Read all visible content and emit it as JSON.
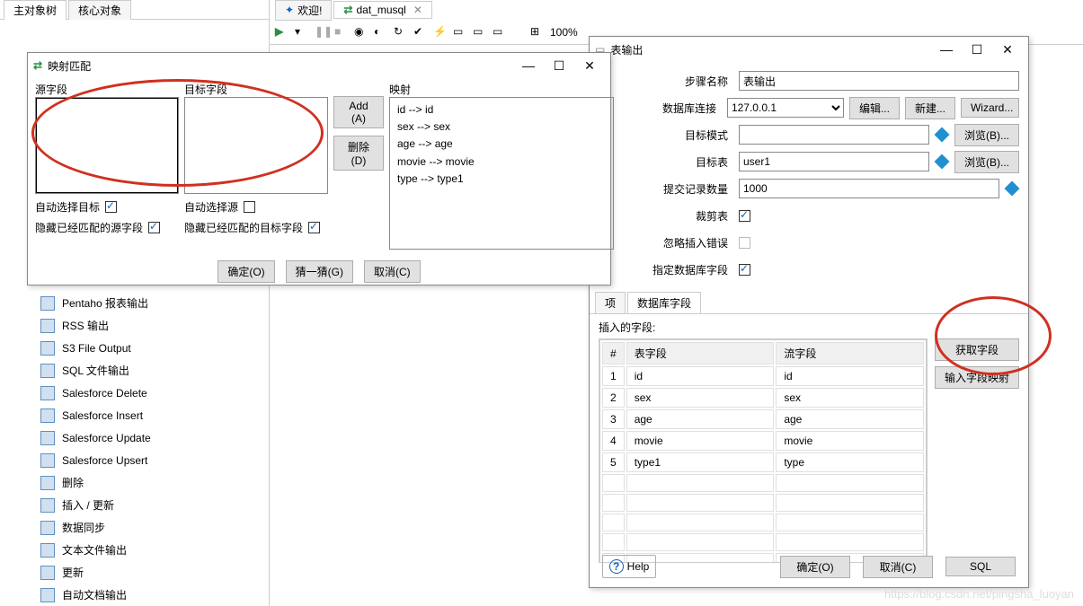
{
  "bg_tabs": {
    "t1": "主对象树",
    "t2": "核心对象"
  },
  "editor_tabs": {
    "welcome": "欢迎!",
    "file": "dat_musql",
    "close_glyph": "✕"
  },
  "toolbar": {
    "zoom": "100%"
  },
  "tree": {
    "items": [
      "Pentaho 报表输出",
      "RSS 输出",
      "S3 File Output",
      "SQL 文件输出",
      "Salesforce Delete",
      "Salesforce Insert",
      "Salesforce Update",
      "Salesforce Upsert",
      "删除",
      "插入 / 更新",
      "数据同步",
      "文本文件输出",
      "更新",
      "自动文档输出"
    ]
  },
  "map_dialog": {
    "title": "映射匹配",
    "src_label": "源字段",
    "tgt_label": "目标字段",
    "mapping_label": "映射",
    "add_btn": "Add (A)",
    "del_btn": "删除(D)",
    "auto_sel_tgt": "自动选择目标",
    "auto_sel_src": "自动选择源",
    "hide_matched_src": "隐藏已经匹配的源字段",
    "hide_matched_tgt": "隐藏已经匹配的目标字段",
    "ok": "确定(O)",
    "guess": "猜一猜(G)",
    "cancel": "取消(C)",
    "mappings": [
      "id --> id",
      "sex --> sex",
      "age --> age",
      "movie --> movie",
      "type --> type1"
    ]
  },
  "out_dialog": {
    "title": "表输出",
    "step_name_label": "步骤名称",
    "step_name": "表输出",
    "conn_label": "数据库连接",
    "conn_value": "127.0.0.1",
    "edit_btn": "编辑...",
    "new_btn": "新建...",
    "wizard_btn": "Wizard...",
    "schema_label": "目标模式",
    "schema_value": "",
    "browse_btn": "浏览(B)...",
    "table_label": "目标表",
    "table_value": "user1",
    "commit_label": "提交记录数量",
    "commit_value": "1000",
    "truncate_label": "裁剪表",
    "ignore_err_label": "忽略插入错误",
    "specify_fields_label": "指定数据库字段",
    "tab_main": "项",
    "tab_fields": "数据库字段",
    "insert_fields_label": "插入的字段:",
    "col_num": "#",
    "col_table": "表字段",
    "col_stream": "流字段",
    "get_fields_btn": "获取字段",
    "enter_mapping_btn": "输入字段映射",
    "rows": [
      {
        "n": "1",
        "t": "id",
        "s": "id"
      },
      {
        "n": "2",
        "t": "sex",
        "s": "sex"
      },
      {
        "n": "3",
        "t": "age",
        "s": "age"
      },
      {
        "n": "4",
        "t": "movie",
        "s": "movie"
      },
      {
        "n": "5",
        "t": "type1",
        "s": "type"
      }
    ],
    "help": "Help",
    "ok": "确定(O)",
    "cancel": "取消(C)",
    "sql": "SQL"
  },
  "window_controls": {
    "min": "—",
    "max": "☐",
    "close": "✕"
  },
  "watermark": "https://blog.csdn.net/pingsha_luoyan"
}
